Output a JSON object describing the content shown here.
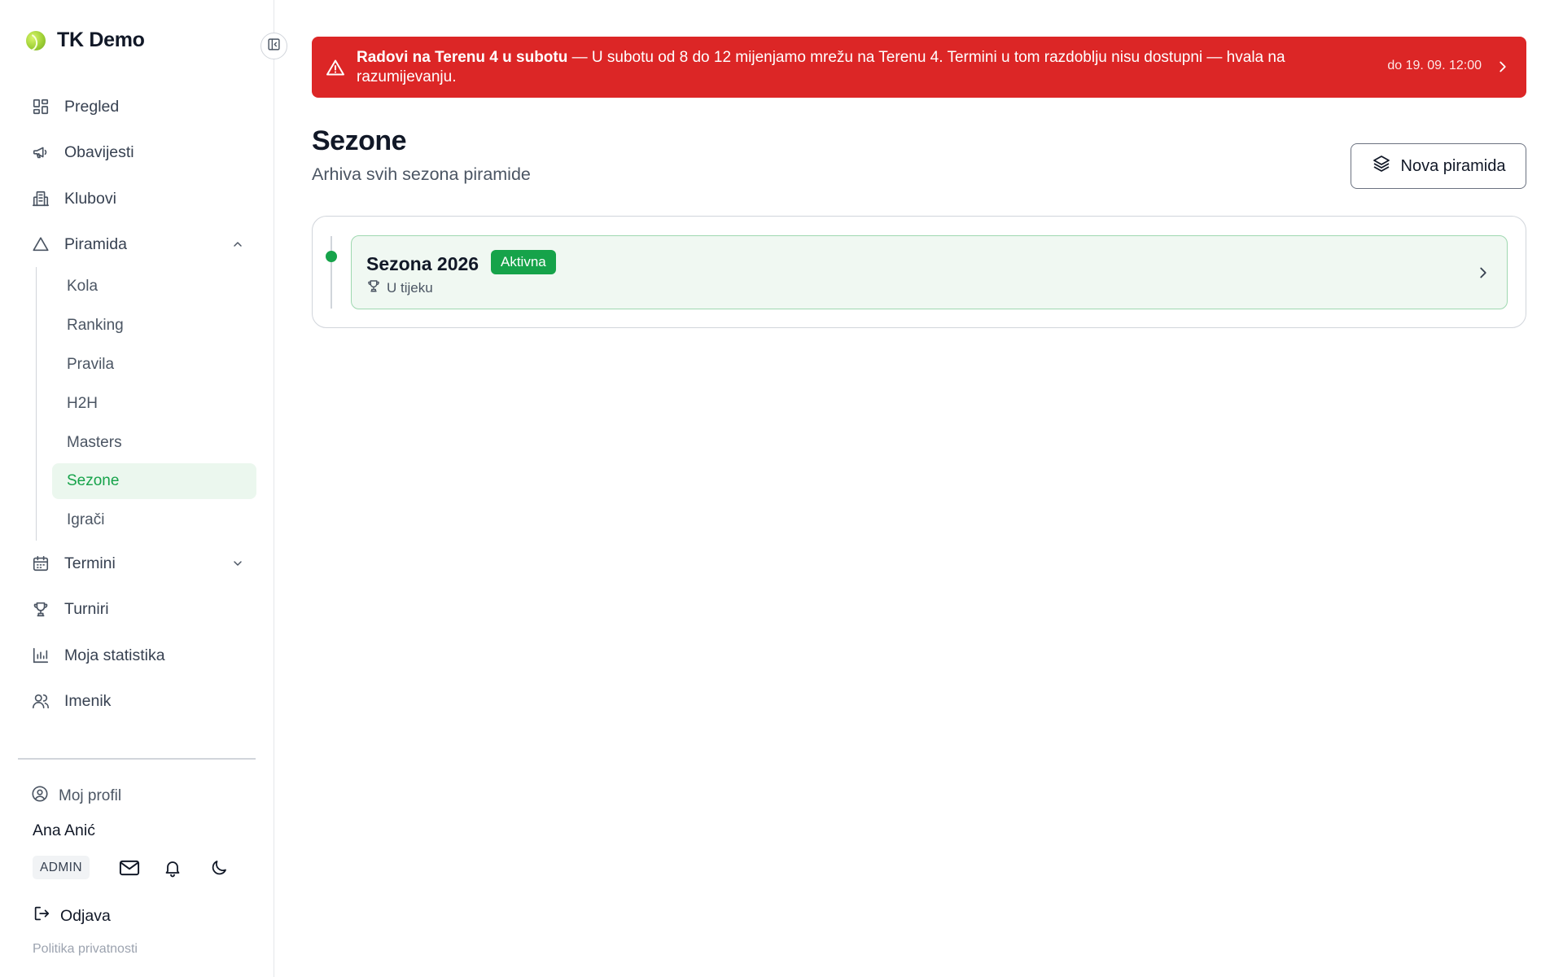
{
  "brand": {
    "name": "TK Demo"
  },
  "nav": {
    "items": [
      {
        "label": "Pregled",
        "icon": "dashboard-icon"
      },
      {
        "label": "Obavijesti",
        "icon": "megaphone-icon"
      },
      {
        "label": "Klubovi",
        "icon": "building-icon"
      },
      {
        "label": "Piramida",
        "icon": "triangle-icon",
        "expanded": true
      },
      {
        "label": "Termini",
        "icon": "calendar-icon",
        "expanded": false
      },
      {
        "label": "Turniri",
        "icon": "trophy-icon"
      },
      {
        "label": "Moja statistika",
        "icon": "bar-chart-icon"
      },
      {
        "label": "Imenik",
        "icon": "users-icon"
      }
    ],
    "sub_items": [
      {
        "label": "Kola"
      },
      {
        "label": "Ranking"
      },
      {
        "label": "Pravila"
      },
      {
        "label": "H2H"
      },
      {
        "label": "Masters"
      },
      {
        "label": "Sezone",
        "active": true
      },
      {
        "label": "Igrači"
      }
    ]
  },
  "profile": {
    "link_label": "Moj profil",
    "user_name": "Ana Anić",
    "role": "ADMIN",
    "logout_label": "Odjava",
    "privacy_label": "Politika privatnosti"
  },
  "alert": {
    "title": "Radovi na Terenu 4 u subotu",
    "message": " — U subotu od 8 do 12 mijenjamo mrežu na Terenu 4. Termini u tom razdoblju nisu dostupni — hvala na razumijevanju.",
    "until": "do 19. 09. 12:00",
    "color": "#dc2626"
  },
  "page": {
    "title": "Sezone",
    "subtitle": "Arhiva svih sezona piramide",
    "new_button_label": "Nova piramida"
  },
  "seasons": [
    {
      "name": "Sezona 2026",
      "badge": "Aktivna",
      "status": "U tijeku"
    }
  ],
  "colors": {
    "accent": "#16a34a",
    "active_bg": "#ebf7ee"
  }
}
